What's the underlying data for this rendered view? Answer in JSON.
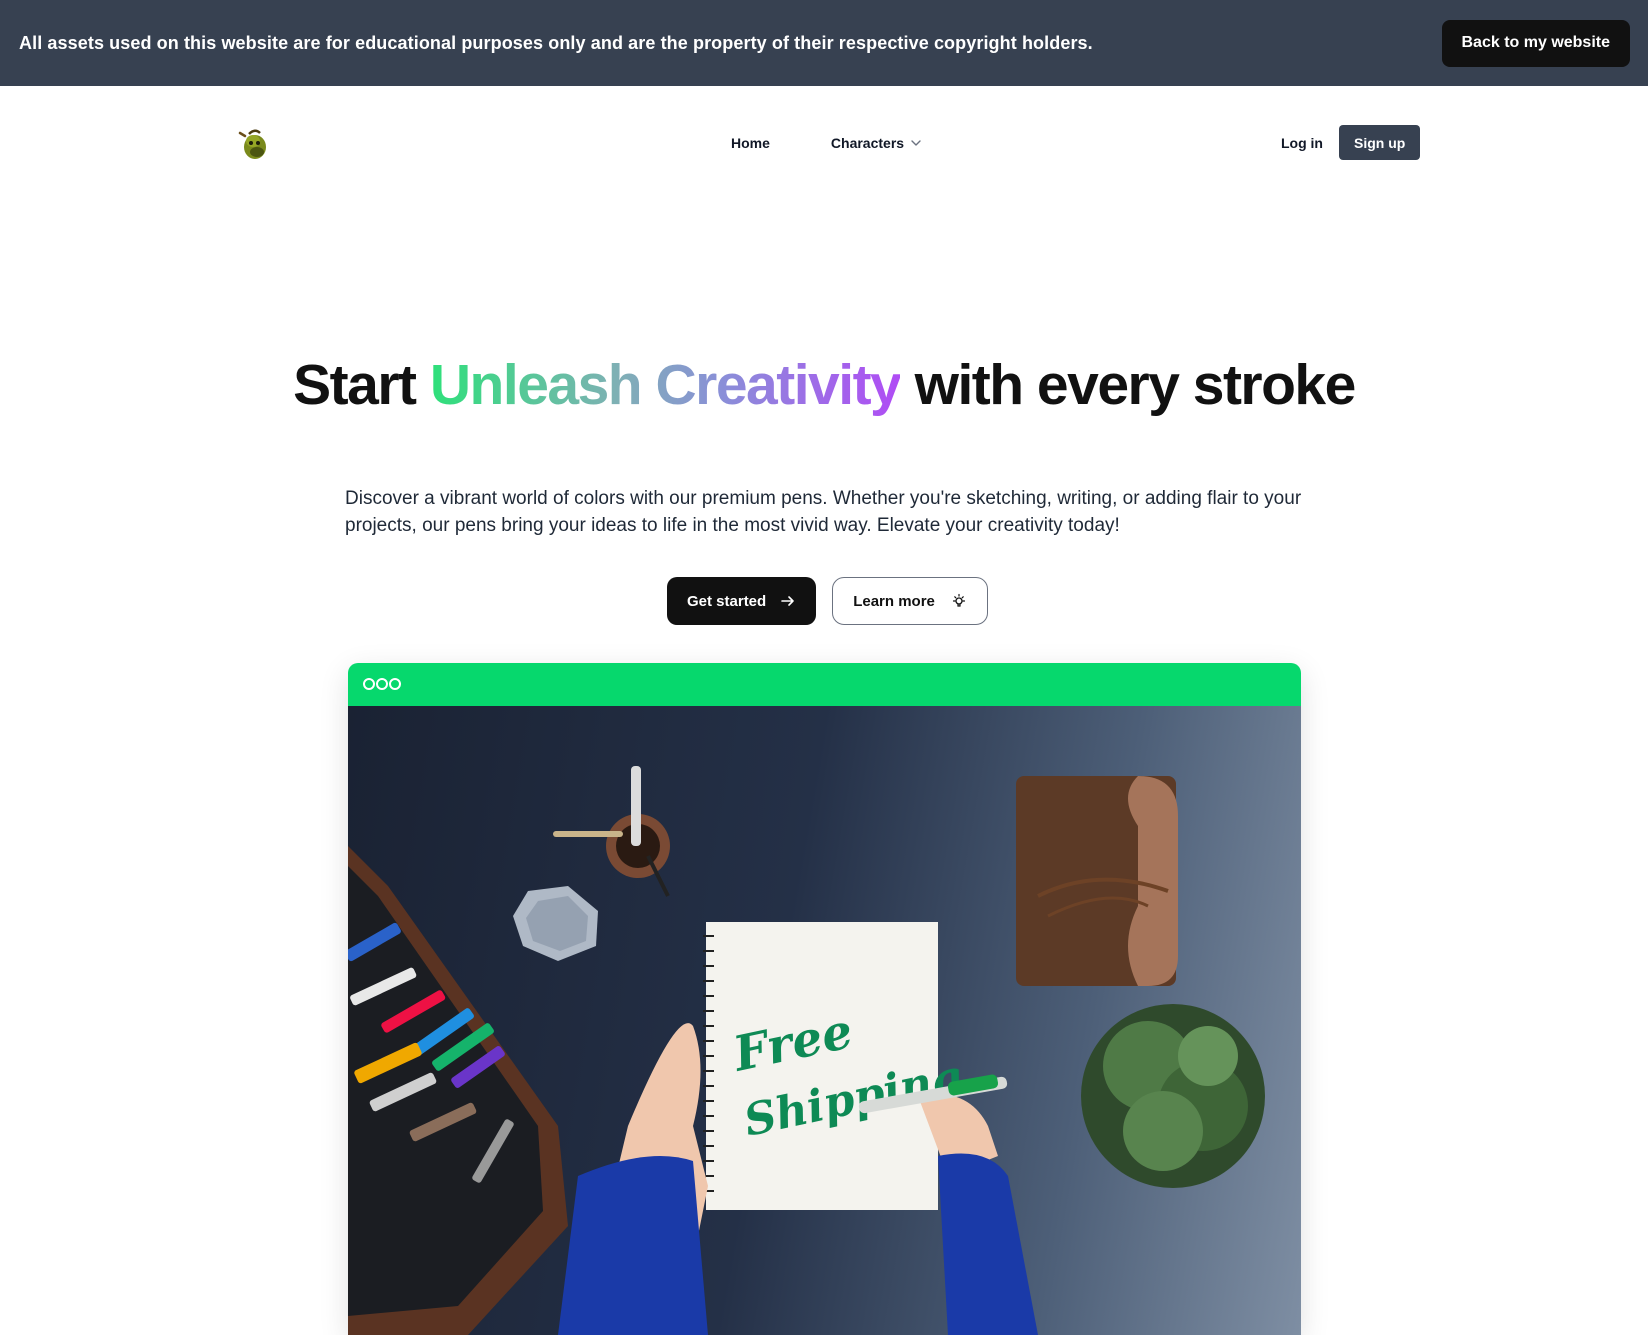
{
  "banner": {
    "text": "All assets used on this website are for educational purposes only and are the property of their respective copyright holders.",
    "button_label": "Back to my website"
  },
  "nav": {
    "logo_icon": "pear-character-icon",
    "links": [
      {
        "label": "Home"
      },
      {
        "label": "Characters",
        "icon": "chevron-down-icon"
      }
    ],
    "login_label": "Log in",
    "signup_label": "Sign up"
  },
  "hero": {
    "title_start": "Start",
    "title_highlight_1": "Unleash",
    "title_highlight_2": "Creativity",
    "title_end": "with every stroke",
    "subtitle": "Discover a vibrant world of colors with our premium pens. Whether you're sketching, writing, or adding flair to your projects, our pens bring your ideas to life in the most vivid way. Elevate your creativity today!",
    "primary_cta": "Get started",
    "primary_cta_icon": "arrow-right-icon",
    "secondary_cta": "Learn more",
    "secondary_cta_icon": "lightbulb-icon"
  },
  "preview": {
    "bar_color": "#06d86d",
    "image_alt": "Hands writing Free Shipping in a notebook with a green pen on a dark desk",
    "notebook_text_line1": "Free",
    "notebook_text_line2": "Shipping"
  },
  "colors": {
    "banner_bg": "#374151",
    "primary_dark": "#111111",
    "signup_bg": "#374151",
    "gradient_start": "#2ee07a",
    "gradient_end": "#b04cf5"
  }
}
